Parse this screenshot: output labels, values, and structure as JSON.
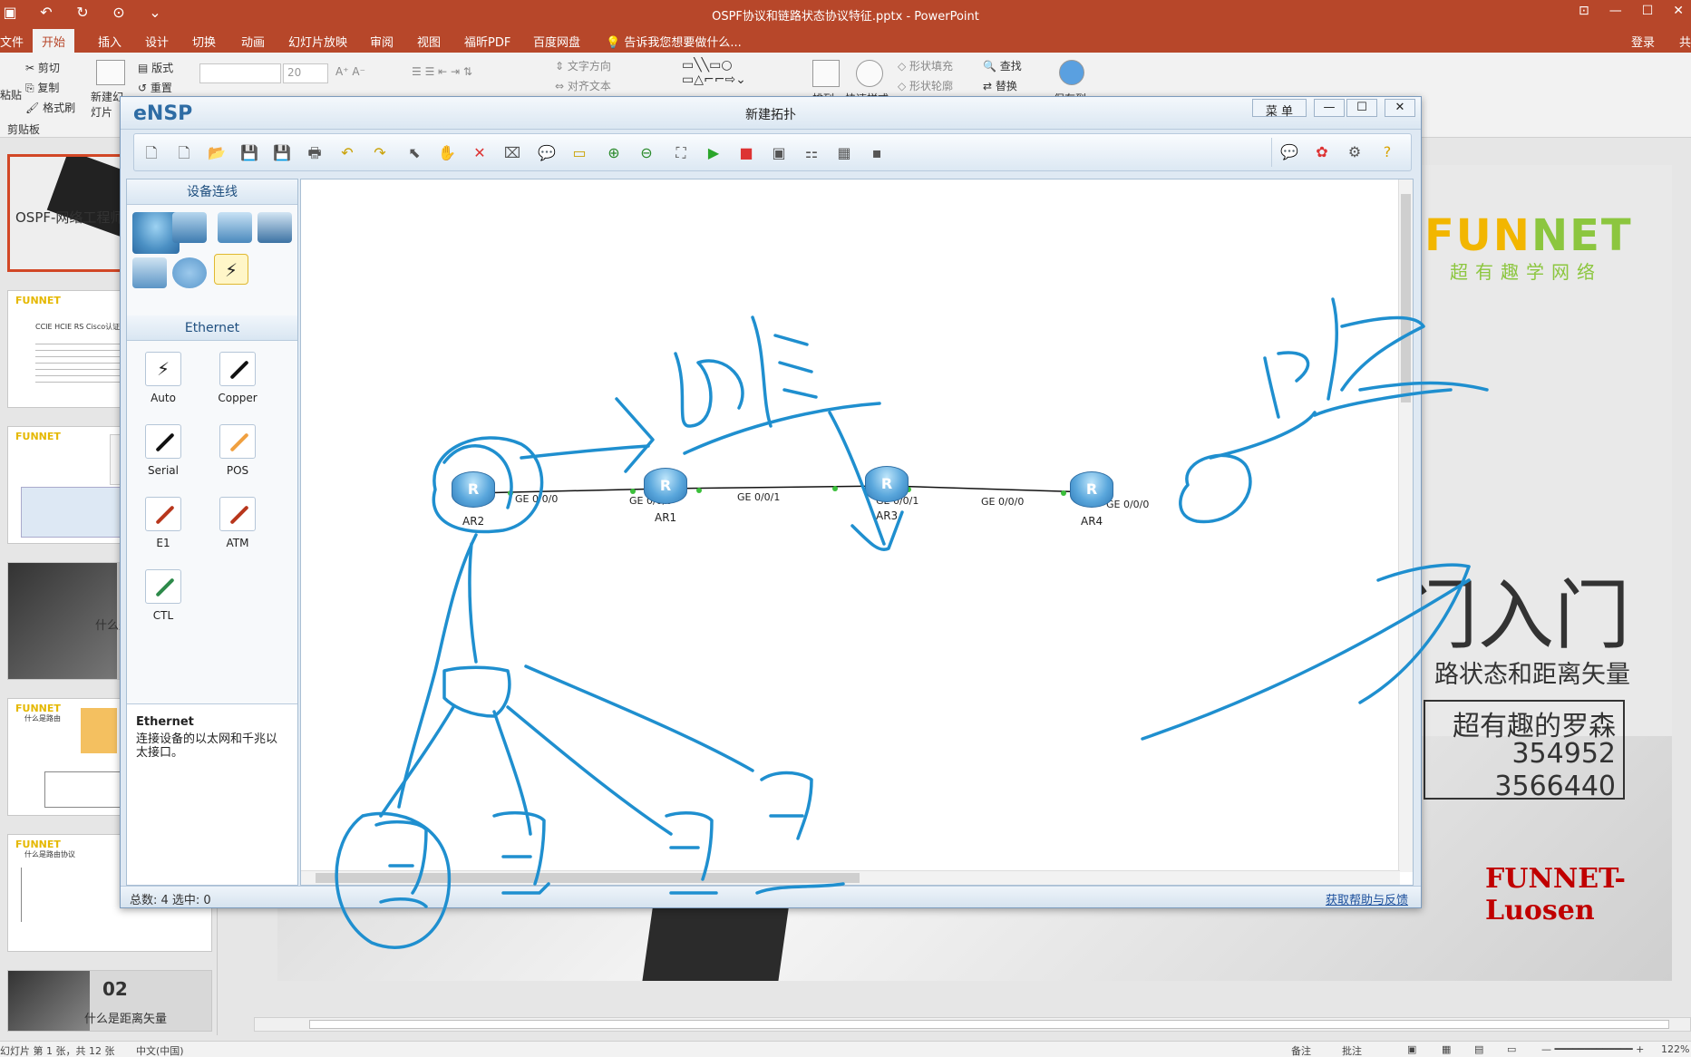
{
  "ppt": {
    "title": "OSPF协议和链路状态协议特征.pptx - PowerPoint",
    "tabs": [
      "文件",
      "开始",
      "插入",
      "设计",
      "切换",
      "动画",
      "幻灯片放映",
      "审阅",
      "视图",
      "福昕PDF",
      "百度网盘"
    ],
    "tell_me": "告诉我您想要做什么...",
    "signin": "登录",
    "share": "共",
    "ribbon": {
      "paste": "粘贴",
      "cut": "剪切",
      "copy": "复制",
      "format_painter": "格式刷",
      "clipboard_group": "剪贴板",
      "new_slide": "新建幻灯片",
      "layout": "版式",
      "reset": "重置",
      "font_size": "20",
      "text_direction": "文字方向",
      "align_text": "对齐文本",
      "shape_fill": "形状填充",
      "shape_outline": "形状轮廓",
      "arrange": "排列",
      "quick_styles": "快速样式",
      "find": "查找",
      "replace": "替换",
      "save_to": "保存到"
    },
    "thumbnails": [
      {
        "text": "OSPF-网络工程师"
      },
      {
        "text": "CCIE HCIE RS Cisco认证课程"
      },
      {
        "text": ""
      },
      {
        "text": "什么是"
      },
      {
        "text": "什么是路由"
      },
      {
        "text": "什么是路由协议"
      },
      {
        "text": "什么是距离矢量",
        "number": "02"
      }
    ],
    "slide": {
      "logo_a": "FUN",
      "logo_b": "NET",
      "slogan": "超有趣学网络",
      "title": "门入门",
      "subtitle": "路状态和距离矢量",
      "name": "超有趣的罗森",
      "num1": "354952",
      "num2": "3566440",
      "watermark": "FUNNET-Luosen"
    },
    "status": {
      "slide_info": "幻灯片 第 1 张，共 12 张",
      "language": "中文(中国)",
      "notes": "备注",
      "comments": "批注",
      "zoom": "122%"
    }
  },
  "ensp": {
    "logo": "eNSP",
    "title": "新建拓扑",
    "menu": "菜 单",
    "panel_header": "设备连线",
    "ethernet_header": "Ethernet",
    "cables": [
      {
        "label": "Auto",
        "color": "#111111"
      },
      {
        "label": "Copper",
        "color": "#111111"
      },
      {
        "label": "Serial",
        "color": "#111111"
      },
      {
        "label": "POS",
        "color": "#f0a040"
      },
      {
        "label": "E1",
        "color": "#b8361c"
      },
      {
        "label": "ATM",
        "color": "#b8361c"
      },
      {
        "label": "CTL",
        "color": "#2d8a4a"
      }
    ],
    "desc_title": "Ethernet",
    "desc_text": "连接设备的以太网和千兆以太接口。",
    "routers": [
      {
        "name": "AR2"
      },
      {
        "name": "AR1"
      },
      {
        "name": "AR3"
      },
      {
        "name": "AR4"
      }
    ],
    "ports": {
      "ar2_ar1_a": "GE 0/0/0",
      "ar2_ar1_b": "GE 0/0/0",
      "ar1_ar3_a": "GE 0/0/1",
      "ar1_ar3_b": "GE 0/0/1",
      "ar3_ar4_a": "GE 0/0/0",
      "ar3_ar4_b": "GE 0/0/0"
    },
    "status_count": "总数: 4  选中: 0",
    "help_link": "获取帮助与反馈"
  }
}
